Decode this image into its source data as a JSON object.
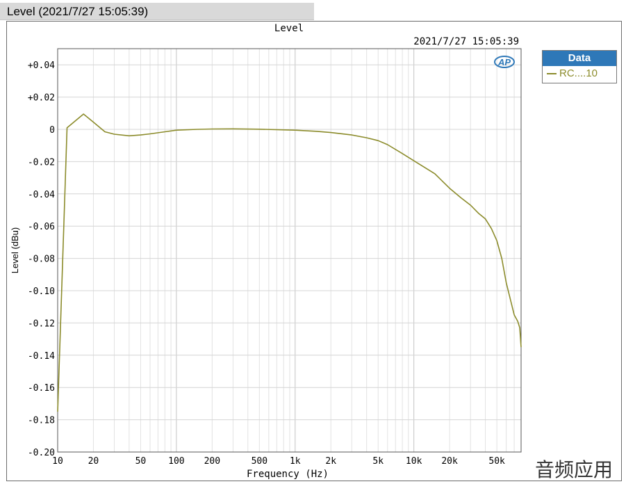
{
  "window": {
    "tab_title": "Level (2021/7/27 15:05:39)"
  },
  "chart_data": {
    "type": "line",
    "title": "Level",
    "subtitle": "2021/7/27 15:05:39",
    "xlabel": "Frequency (Hz)",
    "ylabel": "Level (dBu)",
    "x_scale": "log",
    "xlim": [
      10,
      80000
    ],
    "ylim": [
      -0.2,
      0.05
    ],
    "grid": true,
    "legend_title": "Data",
    "legend_position": "top-right, outside plot",
    "x_tick_labels": [
      "10",
      "20",
      "50",
      "100",
      "200",
      "500",
      "1k",
      "2k",
      "5k",
      "10k",
      "20k",
      "50k"
    ],
    "x_tick_values": [
      10,
      20,
      50,
      100,
      200,
      500,
      1000,
      2000,
      5000,
      10000,
      20000,
      50000
    ],
    "y_tick_labels": [
      "+0.04",
      "+0.02",
      "0",
      "-0.02",
      "-0.04",
      "-0.06",
      "-0.08",
      "-0.10",
      "-0.12",
      "-0.14",
      "-0.16",
      "-0.18",
      "-0.20"
    ],
    "y_tick_values": [
      0.04,
      0.02,
      0,
      -0.02,
      -0.04,
      -0.06,
      -0.08,
      -0.1,
      -0.12,
      -0.14,
      -0.16,
      -0.18,
      -0.2
    ],
    "series": [
      {
        "name": "RC....10",
        "color": "#8b8b2a",
        "x": [
          10,
          12,
          16.5,
          20,
          25,
          30,
          40,
          50,
          60,
          80,
          100,
          150,
          200,
          300,
          500,
          1000,
          1500,
          2000,
          3000,
          4000,
          5000,
          6000,
          8000,
          10000,
          15000,
          20000,
          25000,
          30000,
          35000,
          40000,
          45000,
          50000,
          55000,
          60000,
          70000,
          75000,
          78000,
          80000
        ],
        "y": [
          -0.175,
          0.001,
          0.0095,
          0.0045,
          -0.0015,
          -0.003,
          -0.004,
          -0.0035,
          -0.0028,
          -0.0015,
          -0.0005,
          0.0,
          0.0002,
          0.0003,
          0.0001,
          -0.0005,
          -0.0012,
          -0.002,
          -0.0035,
          -0.0052,
          -0.007,
          -0.0095,
          -0.015,
          -0.0195,
          -0.0275,
          -0.0365,
          -0.0425,
          -0.047,
          -0.052,
          -0.0555,
          -0.0615,
          -0.069,
          -0.08,
          -0.095,
          -0.115,
          -0.119,
          -0.123,
          -0.135
        ]
      }
    ]
  },
  "legend": {
    "header": "Data",
    "entry": "RC....10"
  },
  "branding": {
    "logo_text": "AP",
    "watermark": "音频应用"
  }
}
